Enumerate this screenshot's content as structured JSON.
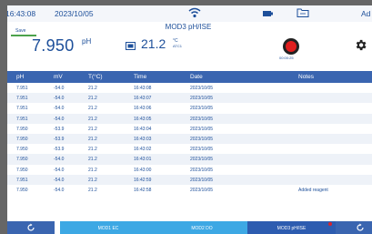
{
  "statusbar": {
    "time": "16:43:08",
    "date": "2023/10/05",
    "user": "Ad"
  },
  "title": {
    "save_label": "Save",
    "channel": "MOD3 pH/ISE"
  },
  "reading": {
    "ph_value": "7.950",
    "ph_unit": "pH",
    "temperature": "21.2",
    "temperature_unit": "°C",
    "temperature_mode": "ATC1",
    "record_timer": "00:00:25"
  },
  "table": {
    "headers": [
      "pH",
      "mV",
      "T(°C)",
      "Time",
      "Date",
      "Notes"
    ],
    "rows": [
      [
        "7.951",
        "-54.0",
        "21.2",
        "16:43:08",
        "2023/10/05",
        ""
      ],
      [
        "7.951",
        "-54.0",
        "21.2",
        "16:43:07",
        "2023/10/05",
        ""
      ],
      [
        "7.951",
        "-54.0",
        "21.2",
        "16:43:06",
        "2023/10/05",
        ""
      ],
      [
        "7.951",
        "-54.0",
        "21.2",
        "16:43:05",
        "2023/10/05",
        ""
      ],
      [
        "7.950",
        "-53.9",
        "21.2",
        "16:43:04",
        "2023/10/05",
        ""
      ],
      [
        "7.950",
        "-53.9",
        "21.2",
        "16:43:03",
        "2023/10/05",
        ""
      ],
      [
        "7.950",
        "-53.9",
        "21.2",
        "16:43:02",
        "2023/10/05",
        ""
      ],
      [
        "7.950",
        "-54.0",
        "21.2",
        "16:43:01",
        "2023/10/05",
        ""
      ],
      [
        "7.950",
        "-54.0",
        "21.2",
        "16:43:00",
        "2023/10/05",
        ""
      ],
      [
        "7.951",
        "-54.0",
        "21.2",
        "16:42:59",
        "2023/10/05",
        ""
      ],
      [
        "7.950",
        "-54.0",
        "21.2",
        "16:42:58",
        "2023/10/05",
        "Added reagent"
      ]
    ]
  },
  "bottombar": {
    "tabs": [
      "MOD1 EC",
      "MOD2 DO",
      "MOD3 pH/ISE"
    ]
  },
  "colors": {
    "accent_blue": "#3a65b0",
    "tab_light_blue": "#3da8e4",
    "text_blue": "#1d4f9a",
    "record_red": "#e01e1e",
    "save_green": "#4ca24c"
  },
  "icons": [
    "wifi-icon",
    "battery-icon",
    "folder-icon",
    "thermometer-icon",
    "record-icon",
    "gear-icon",
    "refresh-icon"
  ]
}
